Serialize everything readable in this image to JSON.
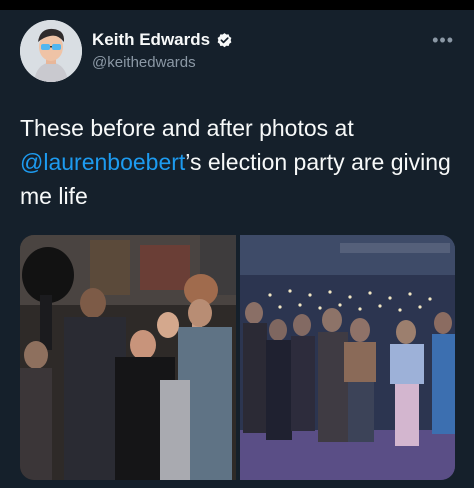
{
  "author": {
    "name": "Keith Edwards",
    "handle": "@keithedwards",
    "verified": true,
    "avatar_icon": "avatar-emoji-sunglasses"
  },
  "menu": {
    "more_label": "•••"
  },
  "tweet": {
    "text_before": "These before and after photos at ",
    "mention": "@laurenboebert",
    "text_after": "’s election party are giving me life"
  },
  "media": {
    "photos": [
      {
        "description_icon": "photo-crowd-cheering"
      },
      {
        "description_icon": "photo-crowd-somber"
      }
    ]
  },
  "colors": {
    "background": "#15202b",
    "text": "#f7f9f9",
    "muted": "#8b98a5",
    "accent": "#1d9bf0"
  }
}
